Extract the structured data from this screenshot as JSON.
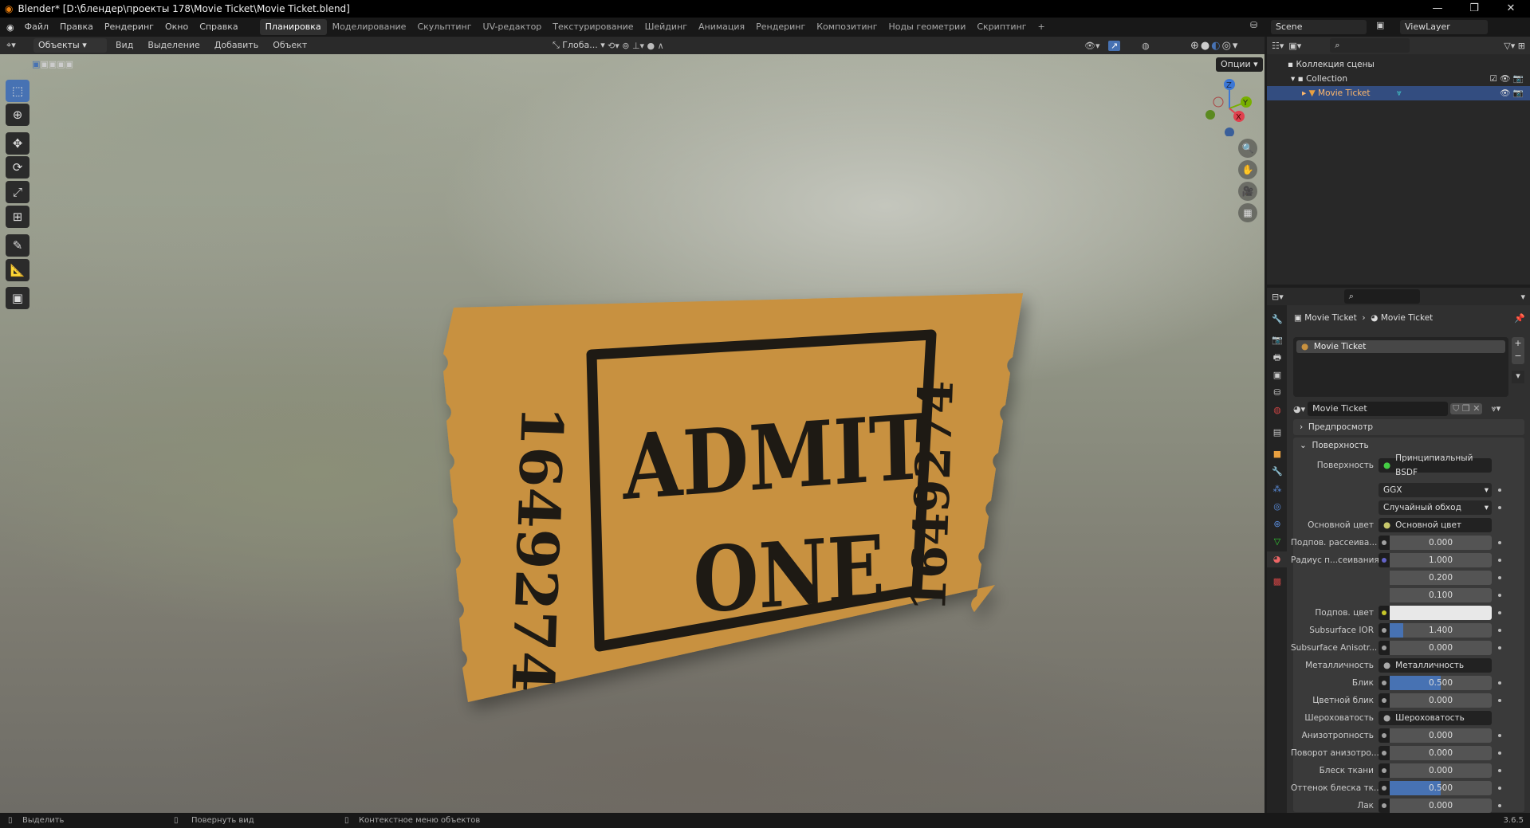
{
  "title": "Blender* [D:\\блендер\\проекты 178\\Movie Ticket\\Movie Ticket.blend]",
  "menu": [
    "Файл",
    "Правка",
    "Рендеринг",
    "Окно",
    "Справка"
  ],
  "workspaces": [
    "Планировка",
    "Моделирование",
    "Скульптинг",
    "UV-редактор",
    "Текстурирование",
    "Шейдинг",
    "Анимация",
    "Рендеринг",
    "Композитинг",
    "Ноды геометрии",
    "Скриптинг"
  ],
  "active_workspace": 0,
  "scene": "Scene",
  "view_layer": "ViewLayer",
  "viewport_header": {
    "mode": "Объекты",
    "menus": [
      "Вид",
      "Выделение",
      "Добавить",
      "Объект"
    ],
    "transform": "Глоба...",
    "options": "Опции"
  },
  "gizmo": {
    "z": "Z",
    "y": "Y",
    "x": "X"
  },
  "ticket": {
    "title1": "ADMIT",
    "title2": "ONE",
    "number": "164927 4",
    "serial": "1649274",
    "color": "#c8913f"
  },
  "outliner": {
    "root": "Коллекция сцены",
    "collection": "Collection",
    "object": "Movie Ticket"
  },
  "properties": {
    "breadcrumb": [
      "Movie Ticket",
      "Movie Ticket"
    ],
    "slot": "Movie Ticket",
    "material": "Movie Ticket",
    "panels": {
      "preview": "Предпросмотр",
      "surface": "Поверхность"
    },
    "surface_label": "Поверхность",
    "surface_value": "Принципиальный BSDF",
    "distribution": "GGX",
    "subsurface_method": "Случайный обход",
    "rows": [
      {
        "label": "Основной цвет",
        "link": "Основной цвет",
        "sock": "#c7c76b"
      },
      {
        "label": "Подпов. рассеива...",
        "value": "0.000",
        "fill": 0
      },
      {
        "label": "Радиус п...сеивания",
        "value": "1.000",
        "fill": 0,
        "sock": "#6363c7"
      },
      {
        "label": "",
        "value": "0.200",
        "fill": 0
      },
      {
        "label": "",
        "value": "0.100",
        "fill": 0
      },
      {
        "label": "Подпов. цвет",
        "color": "#e8e8e8",
        "sock": "#c7c729"
      },
      {
        "label": "Subsurface IOR",
        "value": "1.400",
        "fill": 0.13
      },
      {
        "label": "Subsurface Anisotr...",
        "value": "0.000",
        "fill": 0
      },
      {
        "label": "Металличность",
        "link": "Металличность"
      },
      {
        "label": "Блик",
        "value": "0.500",
        "fill": 0.5
      },
      {
        "label": "Цветной блик",
        "value": "0.000",
        "fill": 0
      },
      {
        "label": "Шероховатость",
        "link": "Шероховатость"
      },
      {
        "label": "Анизотропность",
        "value": "0.000",
        "fill": 0
      },
      {
        "label": "Поворот анизотро...",
        "value": "0.000",
        "fill": 0
      },
      {
        "label": "Блеск ткани",
        "value": "0.000",
        "fill": 0
      },
      {
        "label": "Оттенок блеска тк...",
        "value": "0.500",
        "fill": 0.5
      },
      {
        "label": "Лак",
        "value": "0.000",
        "fill": 0
      }
    ]
  },
  "status": {
    "select": "Выделить",
    "rotate": "Повернуть вид",
    "context": "Контекстное меню объектов",
    "version": "3.6.5"
  },
  "accent": "#4772b3"
}
